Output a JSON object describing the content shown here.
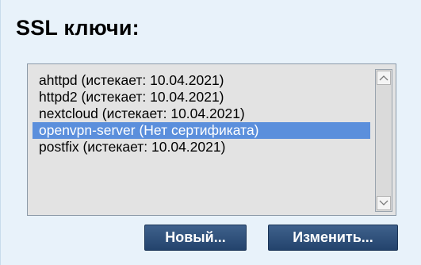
{
  "section": {
    "title": "SSL ключи:"
  },
  "ssl_keys": {
    "items": [
      {
        "label": "ahttpd (истекает: 10.04.2021)",
        "selected": false
      },
      {
        "label": "httpd2 (истекает: 10.04.2021)",
        "selected": false
      },
      {
        "label": "nextcloud (истекает: 10.04.2021)",
        "selected": false
      },
      {
        "label": "openvpn-server (Нет сертификата)",
        "selected": true
      },
      {
        "label": "postfix (истекает: 10.04.2021)",
        "selected": false
      }
    ],
    "selected_index": 3
  },
  "buttons": {
    "new_label": "Новый...",
    "edit_label": "Изменить..."
  },
  "colors": {
    "background": "#e8f2fa",
    "selection": "#5b8fdc",
    "button": "#2f5079"
  },
  "icons": {
    "scroll_up": "chevron-up-icon",
    "scroll_down": "chevron-down-icon"
  }
}
